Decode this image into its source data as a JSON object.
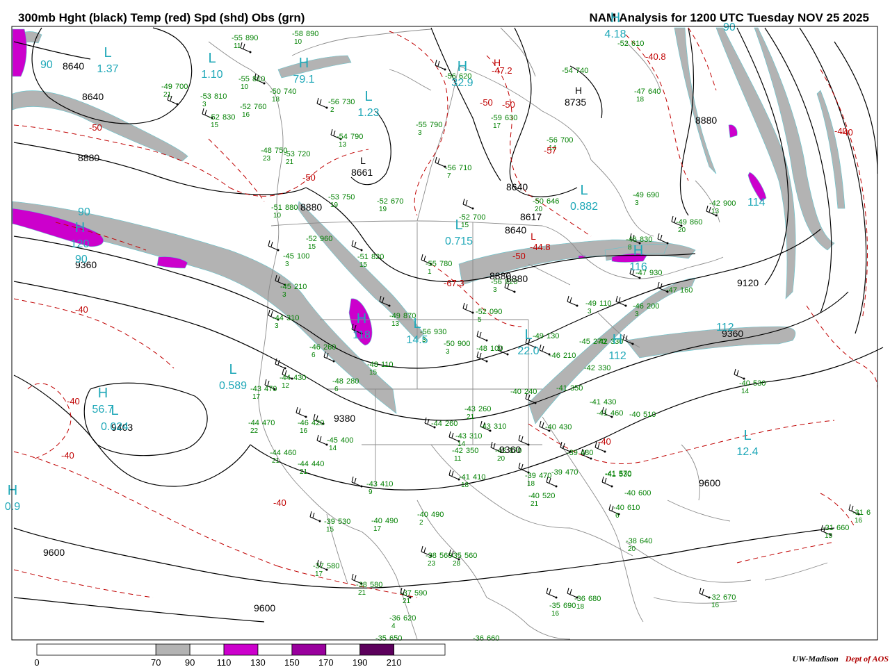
{
  "header": {
    "title": "300mb Hght (black) Temp (red) Spd (shd) Obs (grn)",
    "run": "NAM Analysis for 1200 UTC Tuesday  NOV 25 2025"
  },
  "colors": {
    "height": "#000000",
    "temperature": "#c00000",
    "obs": "#008000",
    "label": "#1fa8b8",
    "shade_70": "#b3b3b3",
    "shade_110": "#cc00cc",
    "shade_150": "#99009d",
    "shade_190": "#5c005c"
  },
  "height_labels": [
    "8640",
    "8640",
    "8880",
    "9360",
    "8880",
    "8661",
    "8880",
    "9120",
    "9360",
    "8640",
    "8617",
    "8640",
    "8735",
    "8880",
    "9360",
    "9403",
    "9600",
    "9600",
    "9600",
    "9380",
    "8880"
  ],
  "temp_labels": [
    "-50",
    "-40",
    "-40",
    "-40",
    "-40",
    "-40",
    "-50",
    "-50",
    "-57",
    "-47.2",
    "-50",
    "-44.8",
    "-50",
    "-40.8",
    "-40",
    "-67.3",
    "-40"
  ],
  "centers": [
    {
      "type": "L",
      "value": "1.37"
    },
    {
      "type": "L",
      "value": "1.10"
    },
    {
      "type": "H",
      "value": "79.1"
    },
    {
      "type": "L",
      "value": "1.23"
    },
    {
      "type": "H",
      "value": "32.9"
    },
    {
      "type": "H",
      "value": "4.18"
    },
    {
      "type": "H",
      "value": "120"
    },
    {
      "type": "L",
      "value": "0.715"
    },
    {
      "type": "L",
      "value": "0.882"
    },
    {
      "type": "H",
      "value": "118"
    },
    {
      "type": "L",
      "value": "14.5"
    },
    {
      "type": "L",
      "value": "22.0"
    },
    {
      "type": "L",
      "value": "0.589"
    },
    {
      "type": "H",
      "value": "56.7"
    },
    {
      "type": "L",
      "value": "0.024"
    },
    {
      "type": "L",
      "value": "12.4"
    },
    {
      "type": "H",
      "value": "116"
    },
    {
      "type": "H",
      "value": "112"
    },
    {
      "type": "H",
      "value": "0.9"
    }
  ],
  "pressure_markers": [
    "L",
    "H",
    "L",
    "H"
  ],
  "speed_labels": [
    "90",
    "90",
    "90",
    "114",
    "112",
    "90"
  ],
  "obs": [
    {
      "t": "-55",
      "h": "890",
      "s": "11"
    },
    {
      "t": "-58",
      "h": "890",
      "s": "10"
    },
    {
      "t": "-49",
      "h": "700",
      "s": "21"
    },
    {
      "t": "-55",
      "h": "810",
      "s": "10"
    },
    {
      "t": "-53",
      "h": "810",
      "s": "3"
    },
    {
      "t": "-50",
      "h": "740",
      "s": "18"
    },
    {
      "t": "-52",
      "h": "760",
      "s": "16"
    },
    {
      "t": "-52",
      "h": "830",
      "s": "15"
    },
    {
      "t": "-56",
      "h": "730",
      "s": "2"
    },
    {
      "t": "-56",
      "h": "620",
      "s": ""
    },
    {
      "t": "-54",
      "h": "740",
      "s": ""
    },
    {
      "t": "-52",
      "h": "610",
      "s": ""
    },
    {
      "t": "-47",
      "h": "640",
      "s": "18"
    },
    {
      "t": "-55",
      "h": "790",
      "s": "3"
    },
    {
      "t": "-59",
      "h": "630",
      "s": "17"
    },
    {
      "t": "-54",
      "h": "790",
      "s": "13"
    },
    {
      "t": "-48",
      "h": "750",
      "s": "23"
    },
    {
      "t": "-53",
      "h": "720",
      "s": "21"
    },
    {
      "t": "-56",
      "h": "710",
      "s": "7"
    },
    {
      "t": "-56",
      "h": "700",
      "s": "14"
    },
    {
      "t": "-53",
      "h": "750",
      "s": "19"
    },
    {
      "t": "-52",
      "h": "670",
      "s": "19"
    },
    {
      "t": "-50",
      "h": "646",
      "s": "20"
    },
    {
      "t": "-49",
      "h": "690",
      "s": "3"
    },
    {
      "t": "-42",
      "h": "900",
      "s": "13"
    },
    {
      "t": "-52",
      "h": "700",
      "s": "15"
    },
    {
      "t": "-51",
      "h": "880",
      "s": "10"
    },
    {
      "t": "-52",
      "h": "960",
      "s": "15"
    },
    {
      "t": "-51",
      "h": "820",
      "s": "15"
    },
    {
      "t": "-49",
      "h": "860",
      "s": "20"
    },
    {
      "t": "-46",
      "h": "830",
      "s": "8"
    },
    {
      "t": "-55",
      "h": "780",
      "s": "1"
    },
    {
      "t": "-56",
      "h": "920",
      "s": "3"
    },
    {
      "t": "-47",
      "h": "930",
      "s": ""
    },
    {
      "t": "-47",
      "h": "160",
      "s": ""
    },
    {
      "t": "-45",
      "h": "100",
      "s": "3"
    },
    {
      "t": "-45",
      "h": "210",
      "s": "3"
    },
    {
      "t": "-44",
      "h": "310",
      "s": "3"
    },
    {
      "t": "-49",
      "h": "870",
      "s": "13"
    },
    {
      "t": "-52",
      "h": "090",
      "s": "5"
    },
    {
      "t": "-49",
      "h": "110",
      "s": "3"
    },
    {
      "t": "-46",
      "h": "200",
      "s": "3"
    },
    {
      "t": "-56",
      "h": "930",
      "s": "3"
    },
    {
      "t": "-50",
      "h": "900",
      "s": "3"
    },
    {
      "t": "-48",
      "h": "100",
      "s": ""
    },
    {
      "t": "-49",
      "h": "130",
      "s": ""
    },
    {
      "t": "-45",
      "h": "270",
      "s": ""
    },
    {
      "t": "-42",
      "h": "330",
      "s": ""
    },
    {
      "t": "-46",
      "h": "260",
      "s": "6"
    },
    {
      "t": "-48",
      "h": "110",
      "s": "15"
    },
    {
      "t": "-46",
      "h": "210",
      "s": ""
    },
    {
      "t": "-42",
      "h": "330",
      "s": ""
    },
    {
      "t": "-44",
      "h": "430",
      "s": "12"
    },
    {
      "t": "-43",
      "h": "470",
      "s": "17"
    },
    {
      "t": "-48",
      "h": "280",
      "s": "6"
    },
    {
      "t": "-40",
      "h": "240",
      "s": ""
    },
    {
      "t": "-41",
      "h": "350",
      "s": ""
    },
    {
      "t": "-41",
      "h": "430",
      "s": ""
    },
    {
      "t": "-41",
      "h": "460",
      "s": ""
    },
    {
      "t": "-40",
      "h": "510",
      "s": ""
    },
    {
      "t": "-40",
      "h": "530",
      "s": "14"
    },
    {
      "t": "-44",
      "h": "470",
      "s": "22"
    },
    {
      "t": "-46",
      "h": "420",
      "s": "16"
    },
    {
      "t": "-45",
      "h": "400",
      "s": "14"
    },
    {
      "t": "-43",
      "h": "260",
      "s": "21"
    },
    {
      "t": "-44",
      "h": "260",
      "s": ""
    },
    {
      "t": "-43",
      "h": "310",
      "s": ""
    },
    {
      "t": "-43",
      "h": "310",
      "s": "14"
    },
    {
      "t": "-40",
      "h": "430",
      "s": ""
    },
    {
      "t": "-42",
      "h": "350",
      "s": "11"
    },
    {
      "t": "-42",
      "h": "370",
      "s": "20"
    },
    {
      "t": "-39",
      "h": "480",
      "s": ""
    },
    {
      "t": "-41",
      "h": "530",
      "s": ""
    },
    {
      "t": "-44",
      "h": "460",
      "s": "21"
    },
    {
      "t": "-44",
      "h": "440",
      "s": "21"
    },
    {
      "t": "-39",
      "h": "470",
      "s": "18"
    },
    {
      "t": "-39",
      "h": "470",
      "s": ""
    },
    {
      "t": "-41",
      "h": "570",
      "s": ""
    },
    {
      "t": "-43",
      "h": "410",
      "s": "9"
    },
    {
      "t": "-41",
      "h": "410",
      "s": "18"
    },
    {
      "t": "-40",
      "h": "520",
      "s": "21"
    },
    {
      "t": "-40",
      "h": "600",
      "s": ""
    },
    {
      "t": "-40",
      "h": "610",
      "s": "6"
    },
    {
      "t": "-39",
      "h": "530",
      "s": "15"
    },
    {
      "t": "-40",
      "h": "490",
      "s": "17"
    },
    {
      "t": "-40",
      "h": "490",
      "s": "2"
    },
    {
      "t": "-38",
      "h": "640",
      "s": "20"
    },
    {
      "t": "-31",
      "h": "660",
      "s": "15"
    },
    {
      "t": "-31",
      "h": "6",
      "s": "16"
    },
    {
      "t": "-38",
      "h": "560",
      "s": "23"
    },
    {
      "t": "-35",
      "h": "560",
      "s": "28"
    },
    {
      "t": "-37",
      "h": "580",
      "s": "17"
    },
    {
      "t": "-38",
      "h": "580",
      "s": "21"
    },
    {
      "t": "-37",
      "h": "590",
      "s": "21"
    },
    {
      "t": "-35",
      "h": "690",
      "s": "16"
    },
    {
      "t": "-36",
      "h": "680",
      "s": "18"
    },
    {
      "t": "-32",
      "h": "670",
      "s": "16"
    },
    {
      "t": "-36",
      "h": "620",
      "s": "4"
    },
    {
      "t": "-35",
      "h": "650",
      "s": ""
    },
    {
      "t": "-36",
      "h": "660",
      "s": ""
    }
  ],
  "legend": {
    "ticks": [
      "0",
      "70",
      "90",
      "110",
      "130",
      "150",
      "170",
      "190",
      "210"
    ],
    "bins": [
      {
        "min": 0,
        "max": 70,
        "color": "#ffffff"
      },
      {
        "min": 70,
        "max": 90,
        "color": "#b3b3b3"
      },
      {
        "min": 90,
        "max": 110,
        "color": "#ffffff"
      },
      {
        "min": 110,
        "max": 130,
        "color": "#cc00cc"
      },
      {
        "min": 130,
        "max": 150,
        "color": "#ffffff"
      },
      {
        "min": 150,
        "max": 170,
        "color": "#99009d"
      },
      {
        "min": 170,
        "max": 190,
        "color": "#ffffff"
      },
      {
        "min": 190,
        "max": 210,
        "color": "#5c005c"
      }
    ]
  },
  "credit": {
    "left": "UW-Madison",
    "right": "Dept of AOS"
  }
}
